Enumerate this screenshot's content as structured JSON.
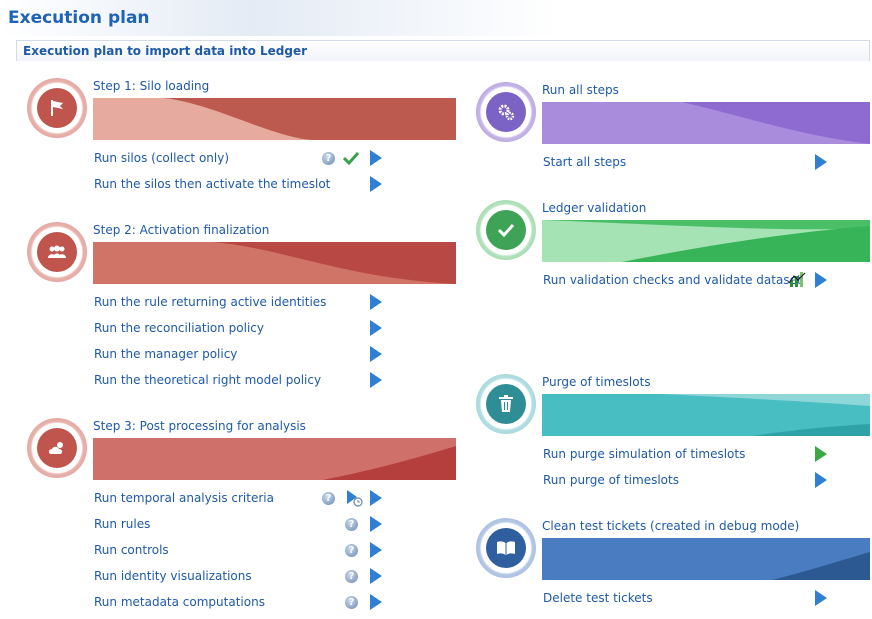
{
  "page": {
    "title": "Execution plan",
    "section_title": "Execution plan to import data into Ledger"
  },
  "colors": {
    "step1": "#c0554d",
    "step2": "#c0554d",
    "step3": "#c0554d",
    "run_all": "#8f6bd0",
    "validation": "#3fba5e",
    "purge": "#3db7be",
    "clean": "#3f73ba",
    "link": "#1e5aa8"
  },
  "steps": [
    {
      "title": "Step 1: Silo loading",
      "icon": "flag-icon",
      "actions": [
        {
          "label": "Run silos (collect only)",
          "help": true,
          "status": "success-check-icon"
        },
        {
          "label": "Run the silos then activate the timeslot"
        }
      ]
    },
    {
      "title": "Step 2: Activation finalization",
      "icon": "people-group-icon",
      "actions": [
        {
          "label": "Run the rule returning active identities"
        },
        {
          "label": "Run the reconciliation policy"
        },
        {
          "label": "Run the manager policy"
        },
        {
          "label": "Run the theoretical right model policy"
        }
      ]
    },
    {
      "title": "Step 3: Post processing for analysis",
      "icon": "weather-cloud-icon",
      "actions": [
        {
          "label": "Run temporal analysis criteria",
          "help": true,
          "status": "scheduled-run-icon"
        },
        {
          "label": "Run rules",
          "help": true
        },
        {
          "label": "Run controls",
          "help": true
        },
        {
          "label": "Run identity visualizations",
          "help": true
        },
        {
          "label": "Run metadata computations",
          "help": true
        }
      ]
    },
    {
      "title": "Run all steps",
      "icon": "gears-icon",
      "actions": [
        {
          "label": "Start all steps"
        }
      ]
    },
    {
      "title": "Ledger validation",
      "icon": "checkmark-icon",
      "actions": [
        {
          "label": "Run validation checks and validate dataset",
          "status": "validation-chart-icon"
        }
      ]
    },
    {
      "title": "Purge of timeslots",
      "icon": "trash-icon",
      "actions": [
        {
          "label": "Run purge simulation of timeslots",
          "play": "green"
        },
        {
          "label": "Run purge of timeslots"
        }
      ]
    },
    {
      "title": "Clean test tickets (created in debug mode)",
      "icon": "book-icon",
      "actions": [
        {
          "label": "Delete test tickets"
        }
      ]
    }
  ]
}
